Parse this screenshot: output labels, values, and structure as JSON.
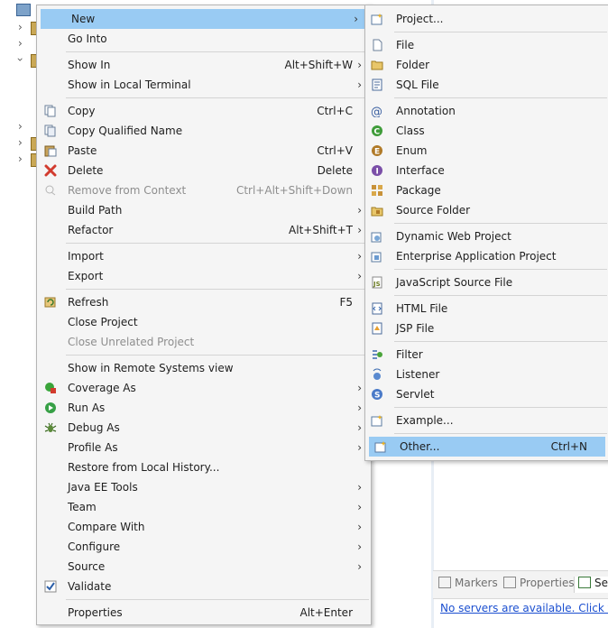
{
  "main_menu": {
    "new": "New",
    "go_into": "Go Into",
    "show_in": "Show In",
    "show_in_acc": "Alt+Shift+W",
    "show_in_terminal": "Show in Local Terminal",
    "copy": "Copy",
    "copy_acc": "Ctrl+C",
    "copy_qualified": "Copy Qualified Name",
    "paste": "Paste",
    "paste_acc": "Ctrl+V",
    "delete": "Delete",
    "delete_acc": "Delete",
    "remove_context": "Remove from Context",
    "remove_context_acc": "Ctrl+Alt+Shift+Down",
    "build_path": "Build Path",
    "refactor": "Refactor",
    "refactor_acc": "Alt+Shift+T",
    "import": "Import",
    "export": "Export",
    "refresh": "Refresh",
    "refresh_acc": "F5",
    "close_project": "Close Project",
    "close_unrelated": "Close Unrelated Project",
    "show_remote": "Show in Remote Systems view",
    "coverage_as": "Coverage As",
    "run_as": "Run As",
    "debug_as": "Debug As",
    "profile_as": "Profile As",
    "restore_history": "Restore from Local History...",
    "java_ee_tools": "Java EE Tools",
    "team": "Team",
    "compare_with": "Compare With",
    "configure": "Configure",
    "source": "Source",
    "validate": "Validate",
    "properties": "Properties",
    "properties_acc": "Alt+Enter"
  },
  "sub_menu": {
    "project": "Project...",
    "file": "File",
    "folder": "Folder",
    "sql_file": "SQL File",
    "annotation": "Annotation",
    "class": "Class",
    "enum": "Enum",
    "interface": "Interface",
    "package": "Package",
    "source_folder": "Source Folder",
    "dynamic_web": "Dynamic Web Project",
    "enterprise_app": "Enterprise Application Project",
    "js_source": "JavaScript Source File",
    "html_file": "HTML File",
    "jsp_file": "JSP File",
    "filter": "Filter",
    "listener": "Listener",
    "servlet": "Servlet",
    "example": "Example...",
    "other": "Other...",
    "other_acc": "Ctrl+N"
  },
  "views": {
    "markers": "Markers",
    "properties": "Properties",
    "servers_partial": "Se",
    "servers_link": "No servers are available. Click this"
  },
  "arrow_glyph": "›",
  "colors": {
    "highlight": "#99cbf3",
    "menu_bg": "#f5f5f5",
    "link": "#1b4fd0"
  }
}
